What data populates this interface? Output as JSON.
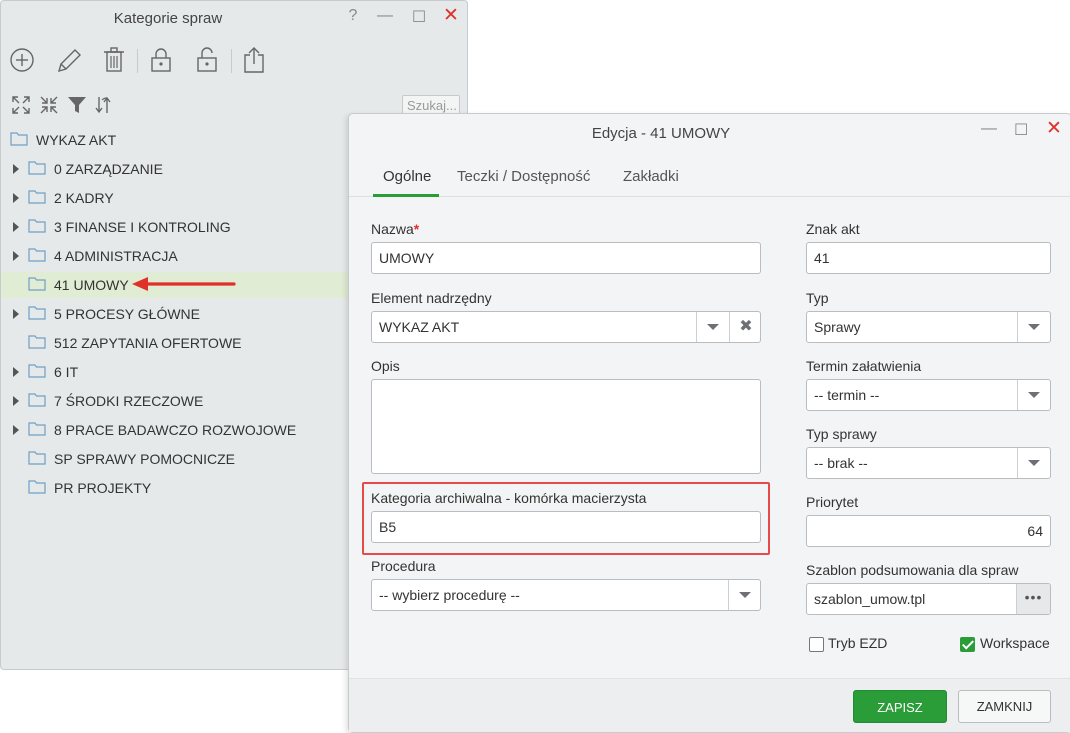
{
  "back_window": {
    "title": "Kategorie spraw",
    "help": "?",
    "search_placeholder": "Szukaj...",
    "toolbar_icons": [
      "add-circle-icon",
      "pencil-icon",
      "trash-icon",
      "lock-icon",
      "unlock-icon",
      "export-icon"
    ],
    "toolbar2_icons": [
      "expand-all-icon",
      "collapse-all-icon",
      "filter-icon",
      "refresh-icon"
    ],
    "tree": {
      "root": "WYKAZ AKT",
      "items": [
        {
          "label": "0 ZARZĄDZANIE",
          "expandable": true
        },
        {
          "label": "2 KADRY",
          "expandable": true
        },
        {
          "label": "3 FINANSE I KONTROLING",
          "expandable": true
        },
        {
          "label": "4 ADMINISTRACJA",
          "expandable": true
        },
        {
          "label": "41 UMOWY",
          "expandable": false,
          "selected": true
        },
        {
          "label": "5 PROCESY GŁÓWNE",
          "expandable": true
        },
        {
          "label": "512 ZAPYTANIA OFERTOWE",
          "expandable": false
        },
        {
          "label": "6 IT",
          "expandable": true
        },
        {
          "label": "7 ŚRODKI RZECZOWE",
          "expandable": true
        },
        {
          "label": "8 PRACE BADAWCZO ROZWOJOWE",
          "expandable": true
        },
        {
          "label": "SP SPRAWY POMOCNICZE",
          "expandable": false
        },
        {
          "label": "PR PROJEKTY",
          "expandable": false
        }
      ]
    }
  },
  "edit_window": {
    "title": "Edycja - 41 UMOWY",
    "tabs": [
      "Ogólne",
      "Teczki / Dostępność",
      "Zakładki"
    ],
    "active_tab": "Ogólne",
    "left": {
      "nazwa_label": "Nazwa",
      "required_mark": "*",
      "nazwa_value": "UMOWY",
      "element_label": "Element nadrzędny",
      "element_value": "WYKAZ AKT",
      "opis_label": "Opis",
      "opis_value": "",
      "kategoria_label": "Kategoria archiwalna - komórka macierzysta",
      "kategoria_value": "B5",
      "procedura_label": "Procedura",
      "procedura_value": "-- wybierz procedurę --"
    },
    "right": {
      "znak_label": "Znak akt",
      "znak_value": "41",
      "typ_label": "Typ",
      "typ_value": "Sprawy",
      "termin_label": "Termin załatwienia",
      "termin_value": "-- termin --",
      "typ_sprawy_label": "Typ sprawy",
      "typ_sprawy_value": "-- brak --",
      "priorytet_label": "Priorytet",
      "priorytet_value": "64",
      "szablon_label": "Szablon podsumowania dla spraw",
      "szablon_value": "szablon_umow.tpl",
      "more": "•••",
      "tryb_ezd_label": "Tryb EZD",
      "tryb_ezd_checked": false,
      "workspace_label": "Workspace",
      "workspace_checked": true
    },
    "buttons": {
      "save": "ZAPISZ",
      "close": "ZAMKNIJ"
    }
  },
  "colors": {
    "accent": "#2a9c38",
    "close": "#e0302a",
    "highlight": "#e84a4a",
    "selected_row": "#e1ecd4"
  }
}
